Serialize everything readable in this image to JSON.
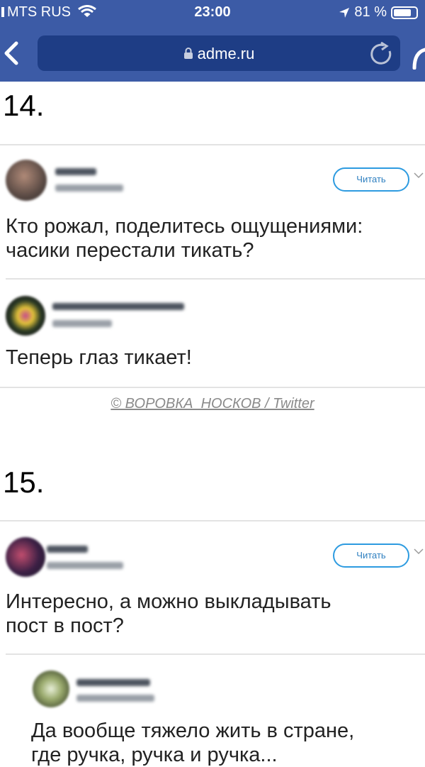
{
  "status_bar": {
    "carrier": "MTS RUS",
    "time": "23:00",
    "battery": "81 %",
    "battery_level": 0.81
  },
  "browser": {
    "url": "adme.ru"
  },
  "items": [
    {
      "number": "14.",
      "tweet": {
        "follow_label": "Читать",
        "text_lines": [
          "Кто рожал, поделитесь ощущениями:",
          "часики перестали тикать?"
        ]
      },
      "reply": {
        "text": "Теперь глаз тикает!"
      },
      "credit": "© ВОРОВКА_НОСКОВ / Twitter"
    },
    {
      "number": "15.",
      "tweet": {
        "follow_label": "Читать",
        "text_lines": [
          "Интересно, а можно выкладывать",
          "пост в пост?"
        ]
      },
      "reply": {
        "text_lines": [
          "Да вообще тяжело жить в стране,",
          "где ручка, ручка и ручка..."
        ]
      }
    }
  ]
}
